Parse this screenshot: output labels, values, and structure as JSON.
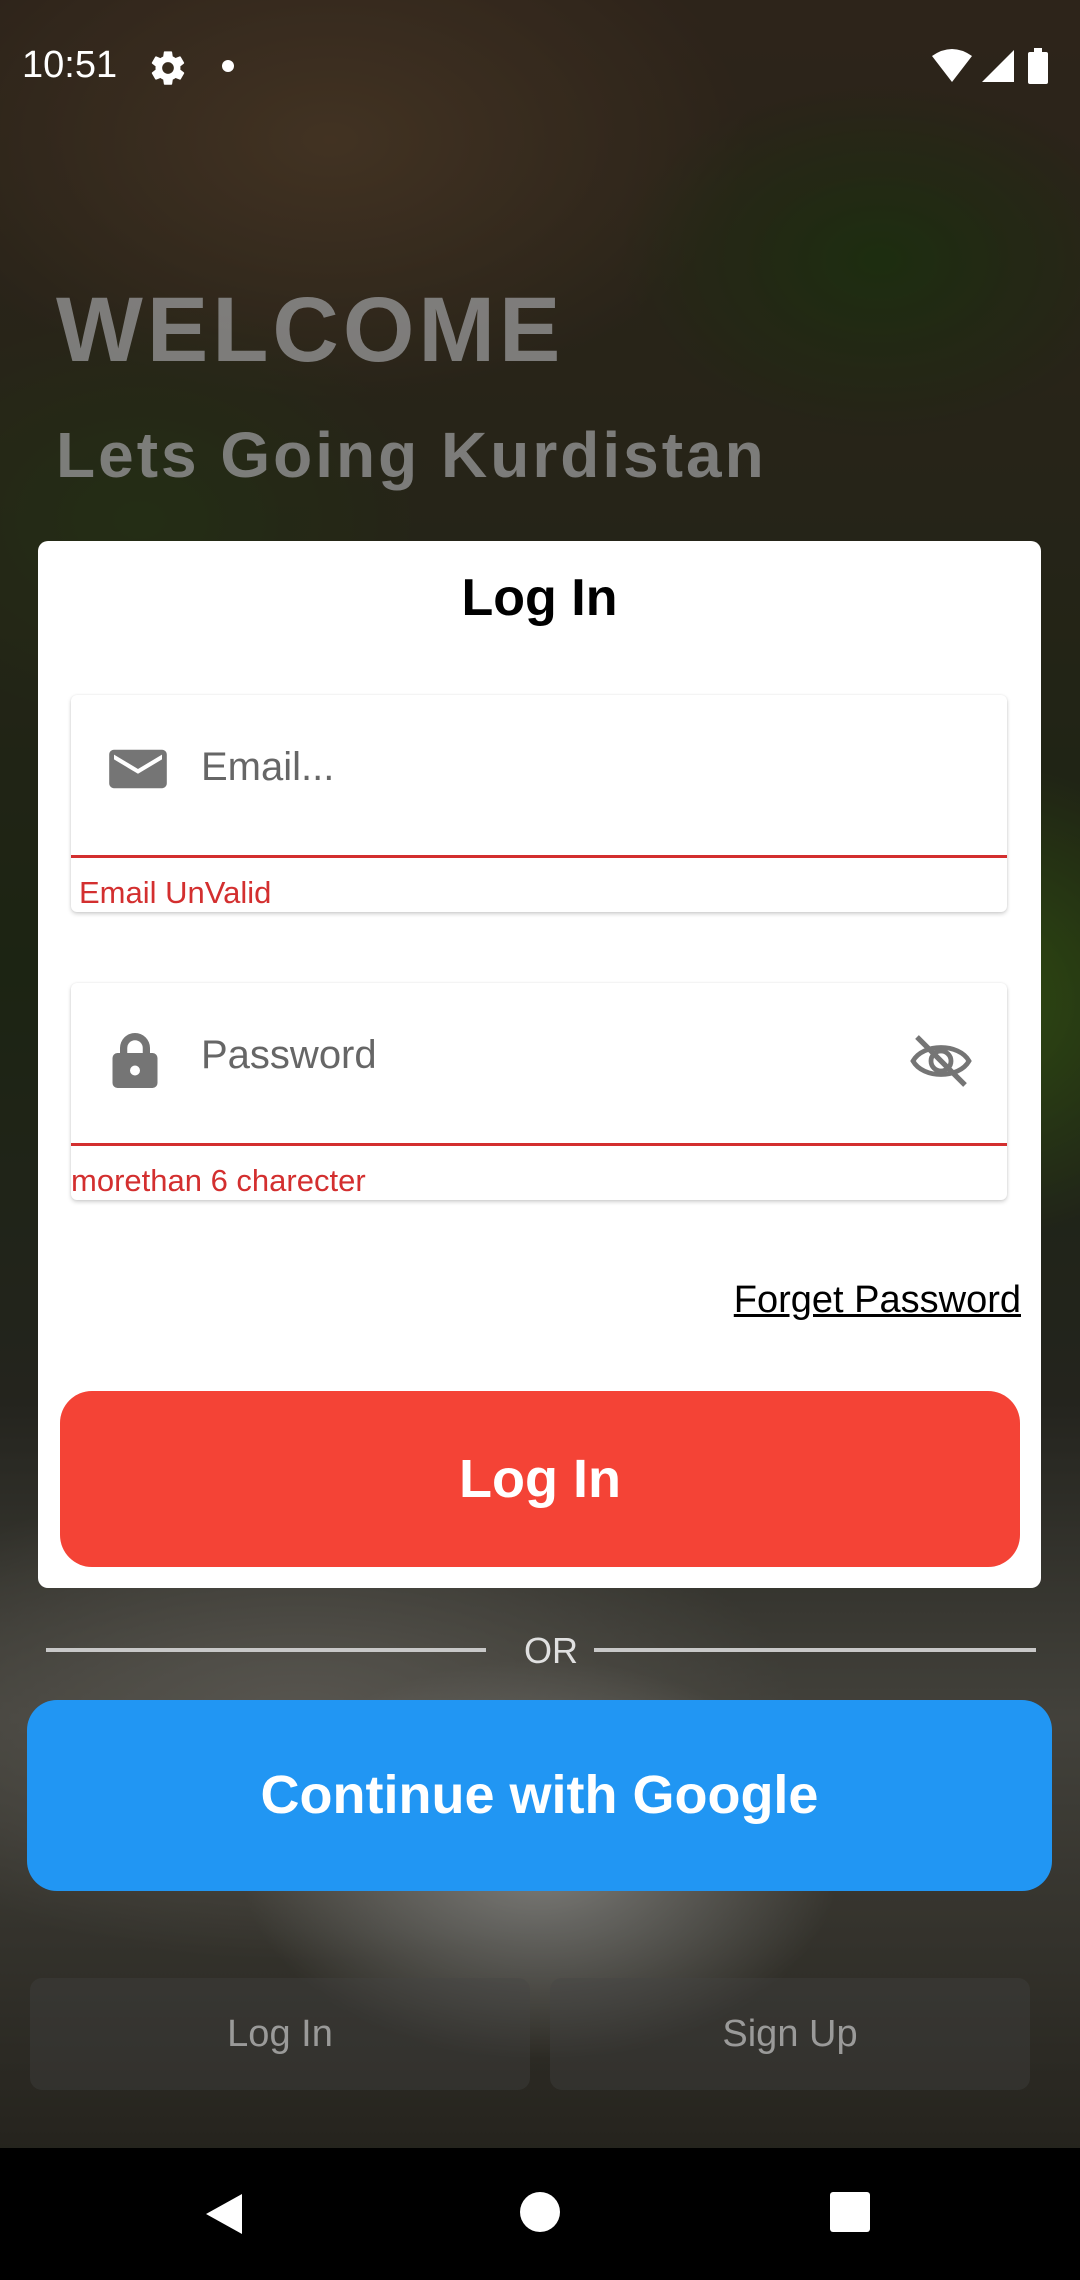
{
  "status_bar": {
    "time": "10:51"
  },
  "header": {
    "welcome": "WELCOME",
    "subtitle": "Lets Going Kurdistan"
  },
  "login_card": {
    "title": "Log In",
    "email": {
      "placeholder": "Email...",
      "error": "Email UnValid",
      "icon": "envelope-icon"
    },
    "password": {
      "placeholder": "Password",
      "error": "morethan 6 charecter",
      "icon": "lock-icon",
      "toggle_icon": "eye-off-icon"
    },
    "forget_password": "Forget Password",
    "login_button": "Log In"
  },
  "divider": {
    "label": "OR"
  },
  "google_button": "Continue with Google",
  "tabs": [
    {
      "label": "Log In"
    },
    {
      "label": "Sign Up"
    }
  ],
  "colors": {
    "login_button": "#f44336",
    "google_button": "#2196f3",
    "error": "#d32f2f"
  }
}
